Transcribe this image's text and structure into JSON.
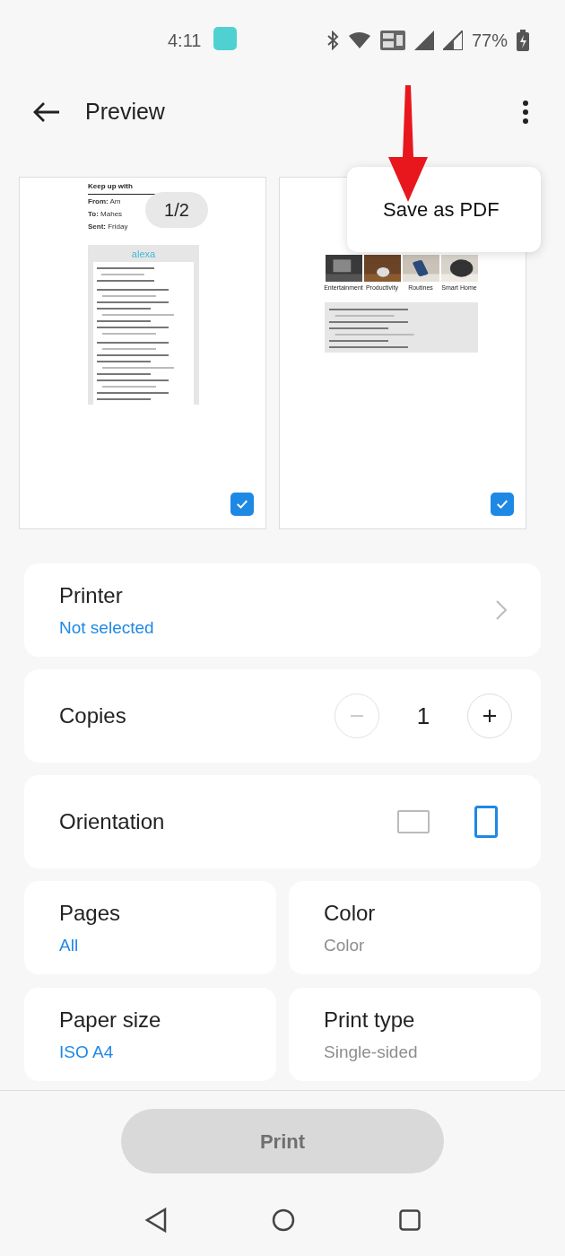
{
  "status_bar": {
    "time": "4:11",
    "battery": "77%"
  },
  "header": {
    "title": "Preview"
  },
  "menu": {
    "items": [
      "Save as PDF"
    ]
  },
  "pages": [
    {
      "indicator": "1/2",
      "checked": true,
      "doc": {
        "title": "Keep up with",
        "meta": [
          {
            "label": "From:",
            "value": "Am"
          },
          {
            "label": "To:",
            "value": "Mahes"
          },
          {
            "label": "Sent:",
            "value": "Friday"
          }
        ],
        "logo": "alexa"
      }
    },
    {
      "checked": true,
      "doc": {
        "categories": [
          "Entertainment",
          "Productivity",
          "Routines",
          "Smart Home"
        ]
      }
    }
  ],
  "settings": {
    "printer": {
      "label": "Printer",
      "value": "Not selected"
    },
    "copies": {
      "label": "Copies",
      "value": "1",
      "decrease_disabled": true
    },
    "orientation": {
      "label": "Orientation",
      "options": [
        {
          "kind": "landscape",
          "selected": false
        },
        {
          "kind": "portrait",
          "selected": true
        }
      ]
    },
    "grid": [
      {
        "label": "Pages",
        "value": "All",
        "disabled": false
      },
      {
        "label": "Color",
        "value": "Color",
        "disabled": true
      },
      {
        "label": "Paper size",
        "value": "ISO A4",
        "disabled": false
      },
      {
        "label": "Print type",
        "value": "Single-sided",
        "disabled": true
      }
    ]
  },
  "print_button": {
    "label": "Print",
    "disabled": true
  }
}
